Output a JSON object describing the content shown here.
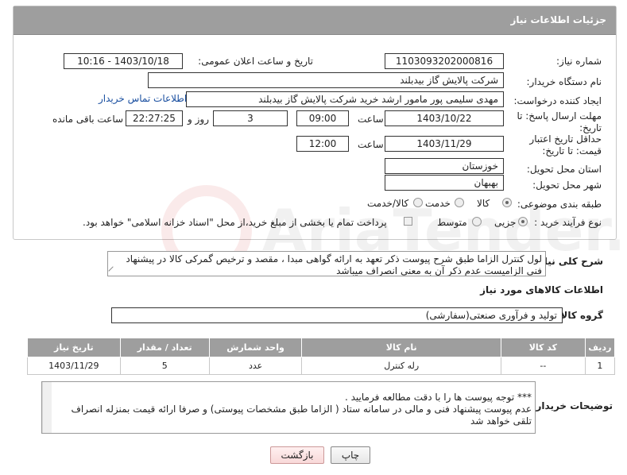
{
  "header": {
    "title": "جزئیات اطلاعات نیاز"
  },
  "form": {
    "need_number_label": "شماره نیاز:",
    "need_number_value": "1103093202000816",
    "announce_label": "تاریخ و ساعت اعلان عمومی:",
    "announce_value": "1403/10/18 - 10:16",
    "buyer_org_label": "نام دستگاه خریدار:",
    "buyer_org_value": "شرکت پالایش گاز بیدبلند",
    "creator_label": "ایجاد کننده درخواست:",
    "creator_value": "مهدی سلیمی پور مامور ارشد خرید شرکت پالایش گاز بیدبلند",
    "contact_link": "اطلاعات تماس خریدار",
    "reply_deadline_label": "مهلت ارسال پاسخ: تا تاریخ:",
    "reply_date": "1403/10/22",
    "time_label": "ساعت",
    "reply_time": "09:00",
    "days_value": "3",
    "days_label": "روز و",
    "remaining_value": "22:27:25",
    "remaining_label": "ساعت باقی مانده",
    "price_validity_label": "حداقل تاریخ اعتبار قیمت: تا تاریخ:",
    "price_date": "1403/11/29",
    "price_time": "12:00",
    "province_label": "استان محل تحویل:",
    "province_value": "خوزستان",
    "city_label": "شهر محل تحویل:",
    "city_value": "بهبهان",
    "category_label": "طبقه بندی موضوعی:",
    "category_options": [
      "کالا",
      "خدمت",
      "کالا/خدمت"
    ],
    "process_label": "نوع فرآیند خرید :",
    "process_options": [
      "جزیی",
      "متوسط"
    ],
    "process_note": "پرداخت تمام یا بخشی از مبلغ خرید،از محل \"اسناد خزانه اسلامی\" خواهد بود."
  },
  "description": {
    "label": "شرح کلی نیاز:",
    "text": "لول کنترل  الزاما طبق شرح  پیوست  ذکر تعهد به ارائه گواهی مبدا ، مقصد و ترخیص گمرکی کالا در پیشنهاد فنی الزامیست عدم ذکر آن به معنی انصراف میباشد"
  },
  "goods": {
    "section_title": "اطلاعات کالاهای مورد نیاز",
    "group_label": "گروه کالا:",
    "group_value": "تولید و فرآوری صنعتی(سفارشی)",
    "columns": [
      "ردیف",
      "کد کالا",
      "نام کالا",
      "واحد شمارش",
      "تعداد / مقدار",
      "تاریخ نیاز"
    ],
    "rows": [
      [
        "1",
        "--",
        "رله کنترل",
        "عدد",
        "5",
        "1403/11/29"
      ]
    ]
  },
  "buyer_notes": {
    "label": "توضیحات خریدار:",
    "line1": "*** توجه پیوست ها  را با دقت مطالعه فرمایید .",
    "line2": "عدم پیوست پیشنهاد فنی و مالی در سامانه ستاد ( الزاما طبق مشخصات پیوستی)  و صرفا ارائه قیمت بمنزله انصراف تلقی خواهد شد"
  },
  "buttons": {
    "print": "چاپ",
    "back": "بازگشت"
  },
  "watermark": {
    "text": "AriaTender.neT"
  }
}
